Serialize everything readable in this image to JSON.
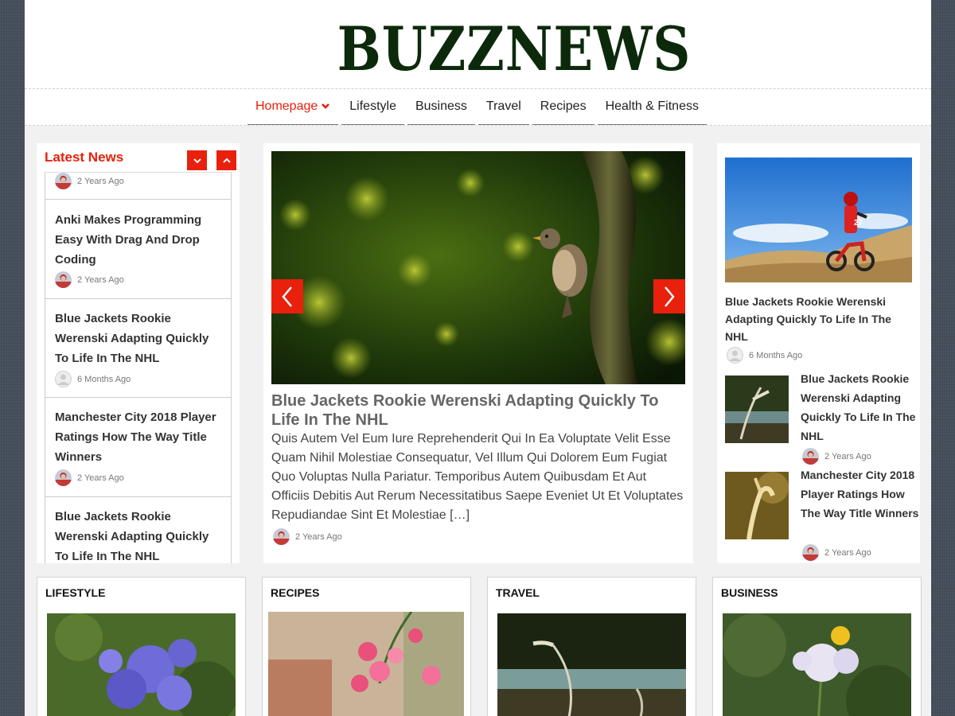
{
  "site": {
    "logo": "BUZZNEWS",
    "accent_color": "#e8200c",
    "logo_color": "#0c2a0b"
  },
  "nav": {
    "items": [
      {
        "label": "Homepage",
        "active": true,
        "icon": "chevron-down-icon"
      },
      {
        "label": "Lifestyle"
      },
      {
        "label": "Business"
      },
      {
        "label": "Travel"
      },
      {
        "label": "Recipes"
      },
      {
        "label": "Health & Fitness"
      }
    ]
  },
  "latest": {
    "title": "Latest News",
    "down_icon": "chevron-down-icon",
    "up_icon": "chevron-up-icon",
    "items": [
      {
        "title": "",
        "time": "2 Years Ago"
      },
      {
        "title": "Anki Makes Programming Easy With Drag And Drop Coding",
        "time": "2 Years Ago"
      },
      {
        "title": "Blue Jackets Rookie Werenski Adapting Quickly To Life In The NHL",
        "time": "6 Months Ago"
      },
      {
        "title": "Manchester City 2018 Player Ratings How The Way Title Winners",
        "time": "2 Years Ago"
      },
      {
        "title": "Blue Jackets Rookie Werenski Adapting Quickly To Life In The NHL",
        "time": ""
      }
    ]
  },
  "slider": {
    "image": "bird-on-tree-photo",
    "prev_icon": "chevron-left-icon",
    "next_icon": "chevron-right-icon",
    "title": "Blue Jackets Rookie Werenski Adapting Quickly To Life In The NHL",
    "excerpt": "Quis Autem Vel Eum Iure Reprehenderit Qui In Ea Voluptate Velit Esse Quam Nihil Molestiae Consequatur, Vel Illum Qui Dolorem Eum Fugiat Quo Voluptas Nulla Pariatur. Temporibus Autem Quibusdam Et Aut Officiis Debitis Aut Rerum Necessitatibus Saepe Eveniet Ut Et Voluptates Repudiandae Sint Et Molestiae […]",
    "time": "2 Years Ago"
  },
  "right": {
    "main": {
      "image": "motocross-photo",
      "title": "Blue Jackets Rookie Werenski Adapting Quickly To Life In The NHL",
      "time": "6 Months Ago"
    },
    "items": [
      {
        "image": "grass-river-photo",
        "title": "Blue Jackets Rookie Werenski Adapting Quickly To Life In The NHL",
        "time": "2 Years Ago"
      },
      {
        "image": "foxtail-grass-photo",
        "title": "Manchester City 2018 Player Ratings How The Way Title Winners",
        "time": "2 Years Ago"
      }
    ]
  },
  "categories": [
    {
      "title": "LIFESTYLE",
      "image": "purple-flower-photo"
    },
    {
      "title": "RECIPES",
      "image": "pink-flower-photo"
    },
    {
      "title": "TRAVEL",
      "image": "grass-river-photo"
    },
    {
      "title": "BUSINESS",
      "image": "white-flower-photo"
    }
  ]
}
